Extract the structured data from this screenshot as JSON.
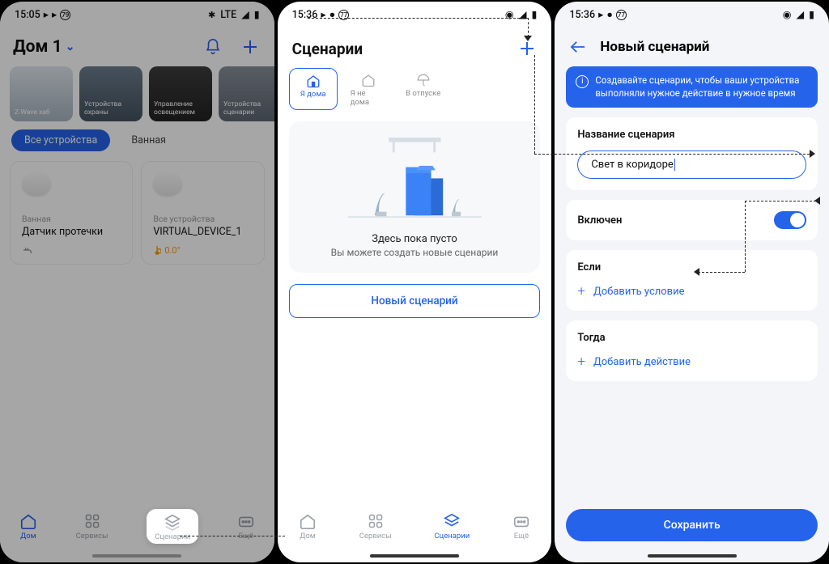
{
  "screen1": {
    "status": {
      "time": "15:05",
      "net": "LTE"
    },
    "title": "Дом 1",
    "cards": [
      "Z-Wave хаб",
      "Устройства охраны",
      "Управление освещением",
      "Устройства сценарии"
    ],
    "chips": {
      "all": "Все устройства",
      "bath": "Ванная"
    },
    "device1": {
      "room": "Ванная",
      "name": "Датчик протечки"
    },
    "device2": {
      "room": "Все устройства",
      "name": "VIRTUAL_DEVICE_1",
      "temp": "0.0°"
    },
    "tabs": {
      "home": "Дом",
      "services": "Сервисы",
      "scenarios": "Сценарии",
      "more": "Ещё"
    }
  },
  "screen2": {
    "status": {
      "time": "15:36"
    },
    "title": "Сценарии",
    "modes": {
      "home": "Я дома",
      "away": "Я не дома",
      "vacation": "В отпуске"
    },
    "empty1": "Здесь пока пусто",
    "empty2": "Вы можете создать новые сценарии",
    "new_btn": "Новый сценарий",
    "tabs": {
      "home": "Дом",
      "services": "Сервисы",
      "scenarios": "Сценарии",
      "more": "Ещё"
    }
  },
  "screen3": {
    "status": {
      "time": "15:36"
    },
    "title": "Новый сценарий",
    "banner": "Создавайте сценарии, чтобы ваши устройства выполняли нужное действие в нужное время",
    "name_label": "Название сценария",
    "name_value": "Свет в коридоре",
    "enabled_label": "Включен",
    "if_label": "Если",
    "add_condition": "Добавить условие",
    "then_label": "Тогда",
    "add_action": "Добавить действие",
    "save": "Сохранить"
  }
}
